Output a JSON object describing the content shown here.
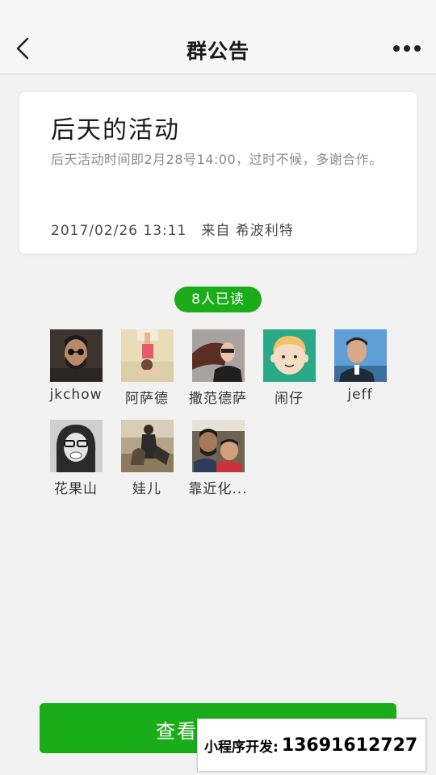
{
  "navbar": {
    "back_icon": "chevron-left-icon",
    "title": "群公告",
    "more_icon": "more-dots-icon"
  },
  "notice": {
    "title": "后天的活动",
    "body": "后天活动时间即2月28号14:00，过时不候，多谢合作。",
    "timestamp": "2017/02/26 13:11",
    "from_label": "来自",
    "author": "希波利特"
  },
  "read_badge": "8人已读",
  "members": [
    {
      "name": "jkchow",
      "avatar": "bearded-man-sunglasses"
    },
    {
      "name": "阿萨德",
      "avatar": "person-headstand"
    },
    {
      "name": "撒范德萨",
      "avatar": "woman-windblown-hair"
    },
    {
      "name": "闹仔",
      "avatar": "cartoon-boy-face"
    },
    {
      "name": "jeff",
      "avatar": "man-suit-sky"
    },
    {
      "name": "花果山",
      "avatar": "woman-glasses-bw"
    },
    {
      "name": "娃儿",
      "avatar": "couple-outdoors"
    },
    {
      "name": "靠近化...",
      "avatar": "man-with-child"
    }
  ],
  "view_button": "查看",
  "watermark": {
    "label": "小程序开发:",
    "phone": "13691612727"
  },
  "colors": {
    "accent_green": "#1aad19",
    "navbar_bg": "#f7f7f7",
    "page_bg": "#f2f2f2"
  }
}
